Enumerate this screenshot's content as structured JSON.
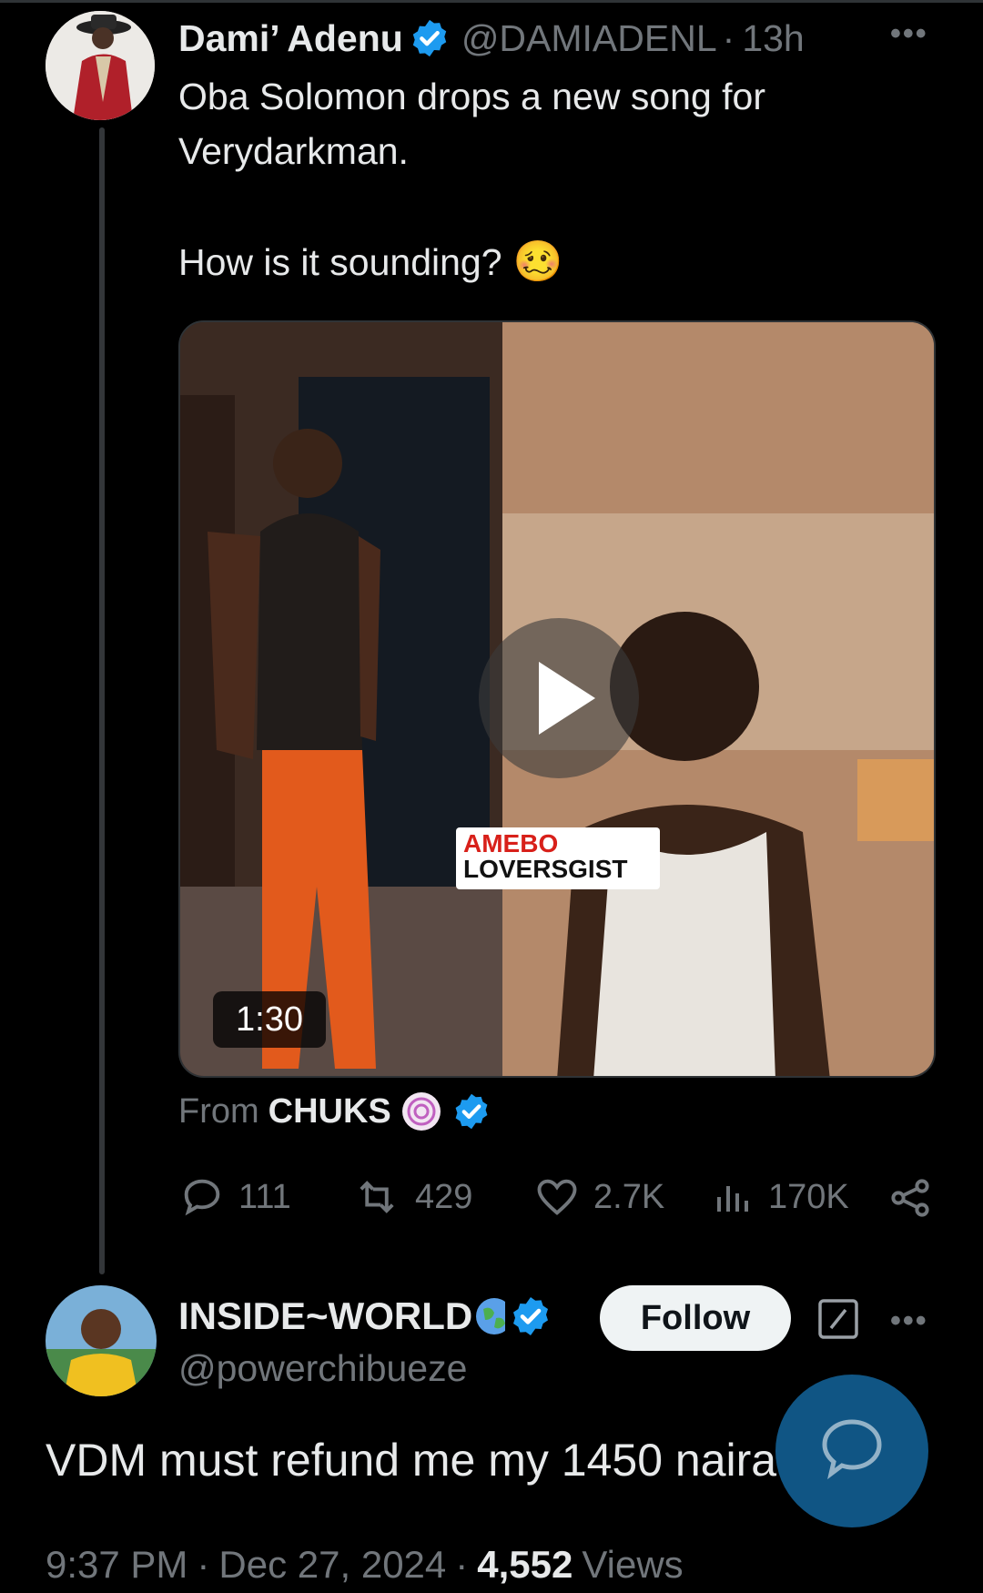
{
  "tweet": {
    "author_name": "Dami’ Adenu",
    "author_handle": "@DAMIADENL",
    "separator": "·",
    "time_ago": "13h",
    "text_line1": "Oba Solomon drops a new song for",
    "text_line2": "Verydarkman.",
    "text_line3": "How is it sounding?",
    "emoji": "🥴",
    "media": {
      "duration": "1:30",
      "watermark_line1": "AMEBO",
      "watermark_line2": "LOVERSGIST"
    },
    "from_prefix": "From",
    "from_source": "CHUKS",
    "actions": {
      "replies": "111",
      "reposts": "429",
      "likes": "2.7K",
      "views": "170K"
    }
  },
  "reply": {
    "author_name": "INSIDE~WORLD",
    "author_handle": "@powerchibueze",
    "follow_label": "Follow",
    "text": "VDM must refund me my 1450 naira",
    "time": "9:37 PM",
    "date": "Dec 27, 2024",
    "views_count": "4,552",
    "views_label": "Views",
    "separator": "·"
  },
  "colors": {
    "background": "#000000",
    "text_primary": "#e7e9ea",
    "text_secondary": "#71767b",
    "verified": "#1d9bf0",
    "follow_bg": "#eff3f4"
  }
}
